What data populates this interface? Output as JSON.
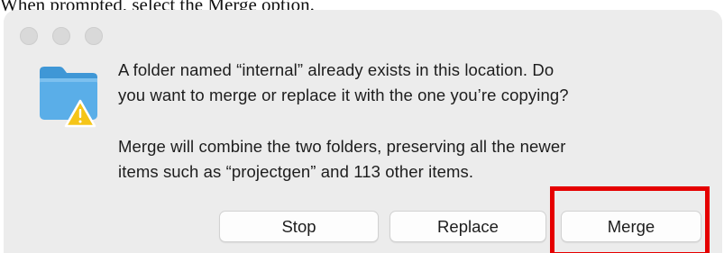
{
  "caption": "When prompted, select the Merge option.",
  "window": {
    "controls": [
      "close",
      "minimize",
      "zoom"
    ]
  },
  "dialog": {
    "icon": "folder-warning-icon",
    "message_lines": [
      "A folder named “internal” already exists in this location. Do",
      "you want to merge or replace it with the one you’re copying?"
    ],
    "detail_lines": [
      "Merge will combine the two folders, preserving all the newer",
      "items such as “projectgen” and 113 other items."
    ]
  },
  "buttons": {
    "stop": "Stop",
    "replace": "Replace",
    "merge": "Merge"
  },
  "colors": {
    "dialog_background": "#ececec",
    "folder": "#5aaee8",
    "warning": "#f5c518",
    "highlight": "#e50000"
  }
}
